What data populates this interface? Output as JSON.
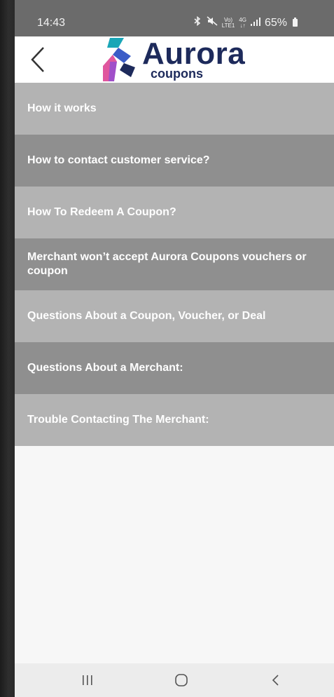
{
  "status_bar": {
    "time": "14:43",
    "network_top": "Vo)",
    "network_bottom": "LTE1",
    "net_type_top": "4G",
    "net_type_bottom": "↓↑",
    "battery": "65%",
    "icons": [
      "bluetooth-icon",
      "mute-icon",
      "volte-icon",
      "signal-icon",
      "battery-icon"
    ]
  },
  "header": {
    "logo_title": "Aurora",
    "logo_sub": "coupons",
    "back_icon": "chevron-left-icon"
  },
  "faq": [
    {
      "label": "How it works"
    },
    {
      "label": "How to contact customer service?"
    },
    {
      "label": "How To Redeem A Coupon?"
    },
    {
      "label": "Merchant won’t accept Aurora Coupons vouchers or coupon"
    },
    {
      "label": "Questions About a Coupon, Voucher, or Deal"
    },
    {
      "label": "Questions About a Merchant:"
    },
    {
      "label": "Trouble Contacting The Merchant:"
    }
  ],
  "nav_bar": {
    "icons": [
      "recent-apps-icon",
      "home-icon",
      "back-icon"
    ]
  },
  "colors": {
    "row_light": "#b3b3b3",
    "row_dark": "#8f8f8f",
    "brand_navy": "#1d2a5b",
    "brand_teal": "#1aa6b7",
    "brand_pink": "#e0569e"
  }
}
